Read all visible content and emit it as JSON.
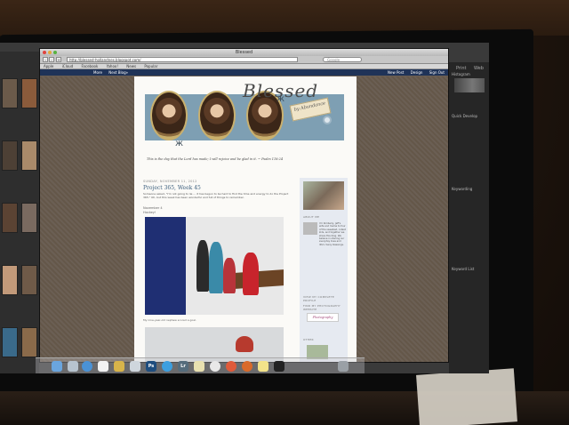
{
  "browser": {
    "window_title": "Blessed",
    "url": "http://blessed-hollandnes.blogspot.com/",
    "search_placeholder": "Google",
    "bookmarks": [
      "Apple",
      "iCloud",
      "Facebook",
      "Yahoo!",
      "News",
      "Popular"
    ],
    "blogger_nav_left": [
      "More",
      "Next Blog»"
    ],
    "blogger_nav_right": [
      "New Post",
      "Design",
      "Sign Out"
    ]
  },
  "blog": {
    "header_title": "Blessed",
    "header_tag": "by Abundance",
    "verse": "This is the day that the Lord has made; I will rejoice and be glad in it. ~ Psalm 118:24",
    "post_date": "SUNDAY, NOVEMBER 11, 2012",
    "post_title": "Project 365, Week 45",
    "post_intro": "Someone asked, \"I'm not going to lie ... it has begun to be hard to find the time and energy to do the Project 365.\" Oh, but this week has been wonderful and full of things to remember.",
    "post_section": "November 4",
    "post_section_note": "Hockey!",
    "caption": "My nine-year-old nephew scored a goal.",
    "sidebar_about": "ABOUT ME",
    "sidebar_about_text": "I'm Kimberly, Jeff's wife and mama to four of the sweetest, cutest kids, and together we share this blog. We believe in sharing our everyday lives and life's many blessings.",
    "sidebar_profile": "VIEW MY COMPLETE PROFILE",
    "sidebar_photography": "FIND MY PHOTOGRAPHY WEBSITE",
    "sidebar_badge": "Photography",
    "sidebar_other": "OTHER"
  },
  "lightroom": {
    "tabs": [
      "Print",
      "Web"
    ],
    "panels": [
      "Histogram",
      "Quick Develop",
      "Keywording",
      "Keyword List"
    ]
  },
  "dock": {
    "icons": [
      "finder-icon",
      "mail-icon",
      "safari-icon",
      "calendar-icon",
      "photos-icon",
      "preview-icon",
      "photoshop-icon",
      "appstore-icon",
      "lightroom-icon",
      "notes-icon",
      "itunes-icon",
      "chrome-icon",
      "firefox-icon",
      "stickies-icon",
      "terminal-icon",
      "trash-icon"
    ],
    "labels": {
      "ps": "Ps",
      "lr": "Lr"
    }
  }
}
